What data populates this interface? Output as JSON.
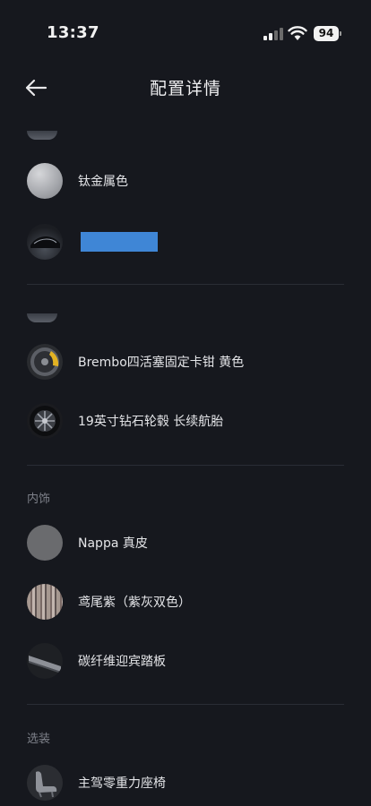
{
  "status": {
    "time": "13:37",
    "battery": "94"
  },
  "header": {
    "title": "配置详情",
    "back_label": "返回"
  },
  "sections": {
    "interior_title": "内饰",
    "optional_title": "选装"
  },
  "items": {
    "paint": "钛金属色",
    "brake": "Brembo四活塞固定卡钳 黄色",
    "wheel": "19英寸钻石轮毂 长续航胎",
    "seat_material": "Nappa 真皮",
    "interior_color": "鸢尾紫（紫灰双色）",
    "door_sill": "碳纤维迎宾踏板",
    "driver_seat": "主驾零重力座椅"
  }
}
